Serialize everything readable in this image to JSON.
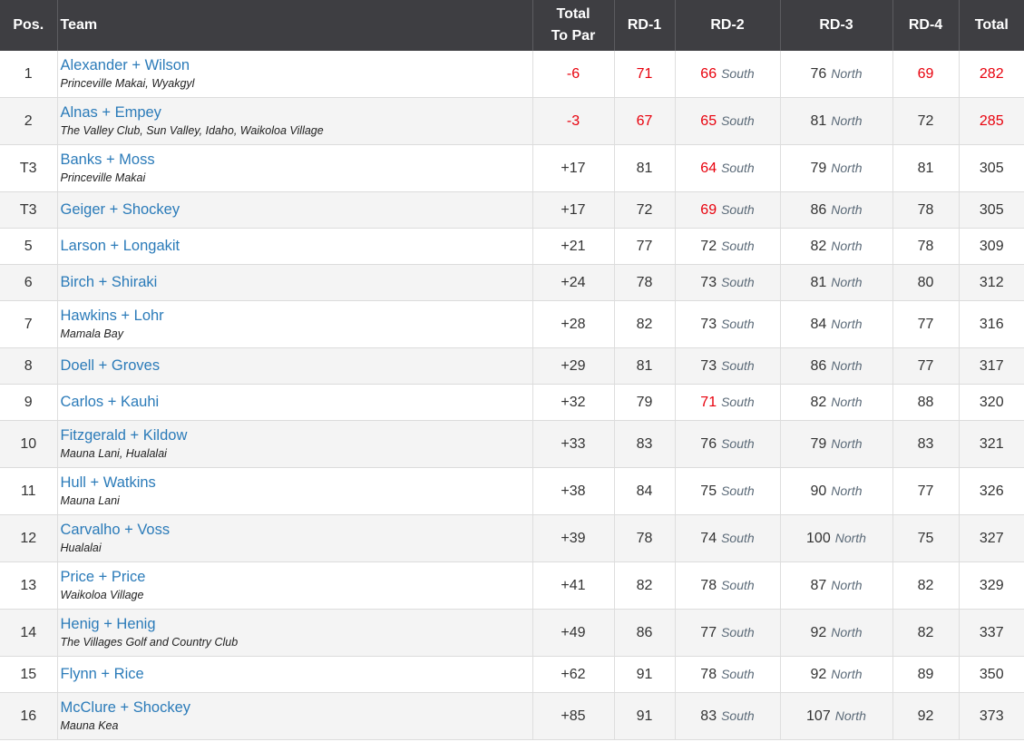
{
  "headers": {
    "pos": "Pos.",
    "team": "Team",
    "to_par_line1": "Total",
    "to_par_line2": "To Par",
    "rd1": "RD-1",
    "rd2": "RD-2",
    "rd3": "RD-3",
    "rd4": "RD-4",
    "total": "Total"
  },
  "colors": {
    "header_bg": "#3e3e42",
    "link": "#2b7bb9",
    "under_par": "#e8000c",
    "course_label": "#5b6a78"
  },
  "rows": [
    {
      "pos": "1",
      "team": "Alexander + Wilson",
      "club": "Princeville Makai, Wyakgyl",
      "to_par": "-6",
      "rd1": "71",
      "rd2": "66",
      "rd2_course": "South",
      "rd3": "76",
      "rd3_course": "North",
      "rd4": "69",
      "total": "282",
      "red": {
        "to_par": true,
        "rd1": true,
        "rd2": true,
        "rd3": false,
        "rd4": true,
        "total": true
      }
    },
    {
      "pos": "2",
      "team": "Alnas + Empey",
      "club": "The Valley Club, Sun Valley, Idaho, Waikoloa Village",
      "to_par": "-3",
      "rd1": "67",
      "rd2": "65",
      "rd2_course": "South",
      "rd3": "81",
      "rd3_course": "North",
      "rd4": "72",
      "total": "285",
      "red": {
        "to_par": true,
        "rd1": true,
        "rd2": true,
        "rd3": false,
        "rd4": false,
        "total": true
      }
    },
    {
      "pos": "T3",
      "team": "Banks + Moss",
      "club": "Princeville Makai",
      "to_par": "+17",
      "rd1": "81",
      "rd2": "64",
      "rd2_course": "South",
      "rd3": "79",
      "rd3_course": "North",
      "rd4": "81",
      "total": "305",
      "red": {
        "to_par": false,
        "rd1": false,
        "rd2": true,
        "rd3": false,
        "rd4": false,
        "total": false
      }
    },
    {
      "pos": "T3",
      "team": "Geiger + Shockey",
      "club": "",
      "to_par": "+17",
      "rd1": "72",
      "rd2": "69",
      "rd2_course": "South",
      "rd3": "86",
      "rd3_course": "North",
      "rd4": "78",
      "total": "305",
      "red": {
        "to_par": false,
        "rd1": false,
        "rd2": true,
        "rd3": false,
        "rd4": false,
        "total": false
      }
    },
    {
      "pos": "5",
      "team": "Larson + Longakit",
      "club": "",
      "to_par": "+21",
      "rd1": "77",
      "rd2": "72",
      "rd2_course": "South",
      "rd3": "82",
      "rd3_course": "North",
      "rd4": "78",
      "total": "309",
      "red": {
        "to_par": false,
        "rd1": false,
        "rd2": false,
        "rd3": false,
        "rd4": false,
        "total": false
      }
    },
    {
      "pos": "6",
      "team": "Birch + Shiraki",
      "club": "",
      "to_par": "+24",
      "rd1": "78",
      "rd2": "73",
      "rd2_course": "South",
      "rd3": "81",
      "rd3_course": "North",
      "rd4": "80",
      "total": "312",
      "red": {
        "to_par": false,
        "rd1": false,
        "rd2": false,
        "rd3": false,
        "rd4": false,
        "total": false
      }
    },
    {
      "pos": "7",
      "team": "Hawkins + Lohr",
      "club": "Mamala Bay",
      "to_par": "+28",
      "rd1": "82",
      "rd2": "73",
      "rd2_course": "South",
      "rd3": "84",
      "rd3_course": "North",
      "rd4": "77",
      "total": "316",
      "red": {
        "to_par": false,
        "rd1": false,
        "rd2": false,
        "rd3": false,
        "rd4": false,
        "total": false
      }
    },
    {
      "pos": "8",
      "team": "Doell + Groves",
      "club": "",
      "to_par": "+29",
      "rd1": "81",
      "rd2": "73",
      "rd2_course": "South",
      "rd3": "86",
      "rd3_course": "North",
      "rd4": "77",
      "total": "317",
      "red": {
        "to_par": false,
        "rd1": false,
        "rd2": false,
        "rd3": false,
        "rd4": false,
        "total": false
      }
    },
    {
      "pos": "9",
      "team": "Carlos + Kauhi",
      "club": "",
      "to_par": "+32",
      "rd1": "79",
      "rd2": "71",
      "rd2_course": "South",
      "rd3": "82",
      "rd3_course": "North",
      "rd4": "88",
      "total": "320",
      "red": {
        "to_par": false,
        "rd1": false,
        "rd2": true,
        "rd3": false,
        "rd4": false,
        "total": false
      }
    },
    {
      "pos": "10",
      "team": "Fitzgerald + Kildow",
      "club": "Mauna Lani, Hualalai",
      "to_par": "+33",
      "rd1": "83",
      "rd2": "76",
      "rd2_course": "South",
      "rd3": "79",
      "rd3_course": "North",
      "rd4": "83",
      "total": "321",
      "red": {
        "to_par": false,
        "rd1": false,
        "rd2": false,
        "rd3": false,
        "rd4": false,
        "total": false
      }
    },
    {
      "pos": "11",
      "team": "Hull + Watkins",
      "club": "Mauna Lani",
      "to_par": "+38",
      "rd1": "84",
      "rd2": "75",
      "rd2_course": "South",
      "rd3": "90",
      "rd3_course": "North",
      "rd4": "77",
      "total": "326",
      "red": {
        "to_par": false,
        "rd1": false,
        "rd2": false,
        "rd3": false,
        "rd4": false,
        "total": false
      }
    },
    {
      "pos": "12",
      "team": "Carvalho + Voss",
      "club": "Hualalai",
      "to_par": "+39",
      "rd1": "78",
      "rd2": "74",
      "rd2_course": "South",
      "rd3": "100",
      "rd3_course": "North",
      "rd4": "75",
      "total": "327",
      "red": {
        "to_par": false,
        "rd1": false,
        "rd2": false,
        "rd3": false,
        "rd4": false,
        "total": false
      }
    },
    {
      "pos": "13",
      "team": "Price + Price",
      "club": "Waikoloa Village",
      "to_par": "+41",
      "rd1": "82",
      "rd2": "78",
      "rd2_course": "South",
      "rd3": "87",
      "rd3_course": "North",
      "rd4": "82",
      "total": "329",
      "red": {
        "to_par": false,
        "rd1": false,
        "rd2": false,
        "rd3": false,
        "rd4": false,
        "total": false
      }
    },
    {
      "pos": "14",
      "team": "Henig + Henig",
      "club": "The Villages Golf and Country Club",
      "to_par": "+49",
      "rd1": "86",
      "rd2": "77",
      "rd2_course": "South",
      "rd3": "92",
      "rd3_course": "North",
      "rd4": "82",
      "total": "337",
      "red": {
        "to_par": false,
        "rd1": false,
        "rd2": false,
        "rd3": false,
        "rd4": false,
        "total": false
      }
    },
    {
      "pos": "15",
      "team": "Flynn + Rice",
      "club": "",
      "to_par": "+62",
      "rd1": "91",
      "rd2": "78",
      "rd2_course": "South",
      "rd3": "92",
      "rd3_course": "North",
      "rd4": "89",
      "total": "350",
      "red": {
        "to_par": false,
        "rd1": false,
        "rd2": false,
        "rd3": false,
        "rd4": false,
        "total": false
      }
    },
    {
      "pos": "16",
      "team": "McClure + Shockey",
      "club": "Mauna Kea",
      "to_par": "+85",
      "rd1": "91",
      "rd2": "83",
      "rd2_course": "South",
      "rd3": "107",
      "rd3_course": "North",
      "rd4": "92",
      "total": "373",
      "red": {
        "to_par": false,
        "rd1": false,
        "rd2": false,
        "rd3": false,
        "rd4": false,
        "total": false
      }
    }
  ]
}
